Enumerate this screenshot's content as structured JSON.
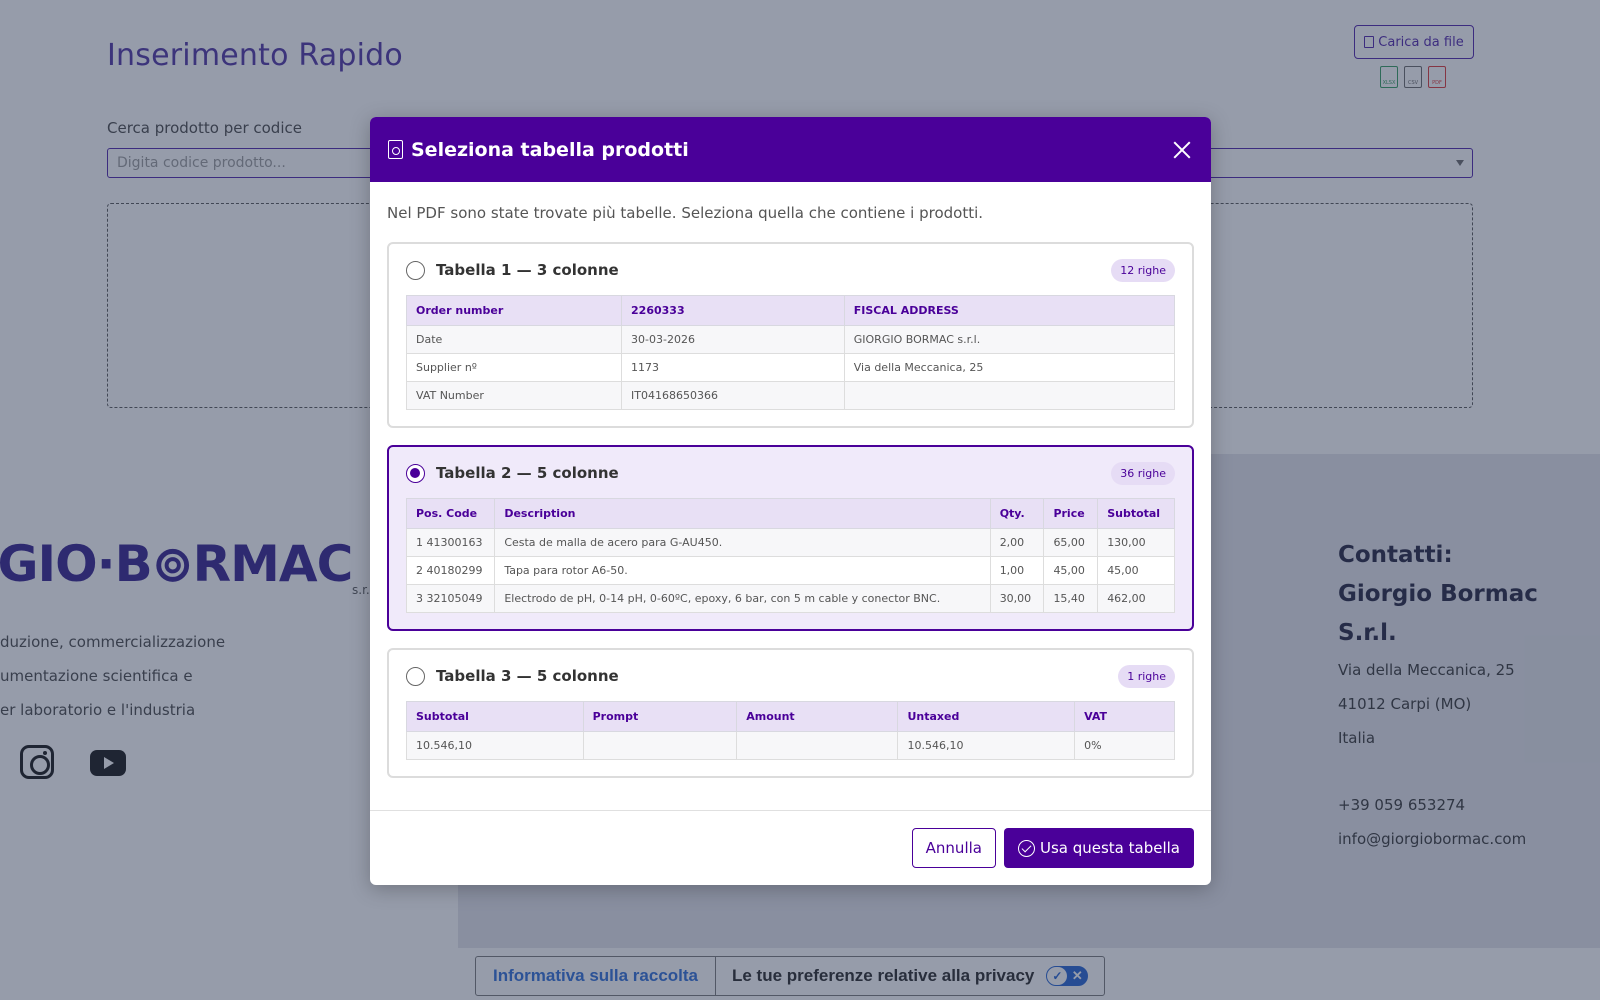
{
  "page": {
    "title": "Inserimento Rapido",
    "upload_button": "Carica da file",
    "file_types": [
      "XLSX",
      "CSV",
      "PDF"
    ],
    "search_label": "Cerca prodotto per codice",
    "search_placeholder": "Digita codice prodotto..."
  },
  "footer": {
    "brand": "RGIO·B⊚RMAC",
    "brand_suffix": "s.r.",
    "desc_lines": [
      "duzione, commercializzazione",
      "umentazione scientifica e",
      "er laboratorio e l'industria"
    ],
    "contacts_title1": "Contatti:",
    "contacts_title2": "Giorgio Bormac S.r.l.",
    "address1": "Via della Meccanica, 25",
    "address2": "41012 Carpi (MO)",
    "country": "Italia",
    "phone": "+39 059 653274",
    "email": "info@giorgiobormac.com"
  },
  "privacy": {
    "left": "Informativa sulla raccolta",
    "right": "Le tue preferenze relative alla privacy"
  },
  "modal": {
    "title": "Seleziona tabella prodotti",
    "intro": "Nel PDF sono state trovate più tabelle. Seleziona quella che contiene i prodotti.",
    "cancel_label": "Annulla",
    "confirm_label": "Usa questa tabella",
    "tables": [
      {
        "title": "Tabella 1 — 3 colonne",
        "badge": "12 righe",
        "selected": false,
        "headers": [
          "Order number",
          "2260333",
          "FISCAL ADDRESS"
        ],
        "rows": [
          [
            "Date",
            "30-03-2026",
            "GIORGIO BORMAC s.r.l."
          ],
          [
            "Supplier nº",
            "1173",
            "Via della Meccanica, 25"
          ],
          [
            "VAT Number",
            "IT04168650366",
            ""
          ]
        ]
      },
      {
        "title": "Tabella 2 — 5 colonne",
        "badge": "36 righe",
        "selected": true,
        "headers": [
          "Pos. Code",
          "Description",
          "Qty.",
          "Price",
          "Subtotal"
        ],
        "rows": [
          [
            "1 41300163",
            "Cesta de malla de acero para G-AU450.",
            "2,00",
            "65,00",
            "130,00"
          ],
          [
            "2 40180299",
            "Tapa para rotor A6-50.",
            "1,00",
            "45,00",
            "45,00"
          ],
          [
            "3 32105049",
            "Electrodo de pH, 0-14 pH, 0-60ºC, epoxy, 6 bar, con 5 m cable y conector BNC.",
            "30,00",
            "15,40",
            "462,00"
          ]
        ]
      },
      {
        "title": "Tabella 3 — 5 colonne",
        "badge": "1 righe",
        "selected": false,
        "headers": [
          "Subtotal",
          "Prompt",
          "Amount",
          "Untaxed",
          "VAT"
        ],
        "rows": [
          [
            "10.546,10",
            "",
            "",
            "10.546,10",
            "0%"
          ]
        ]
      }
    ]
  }
}
